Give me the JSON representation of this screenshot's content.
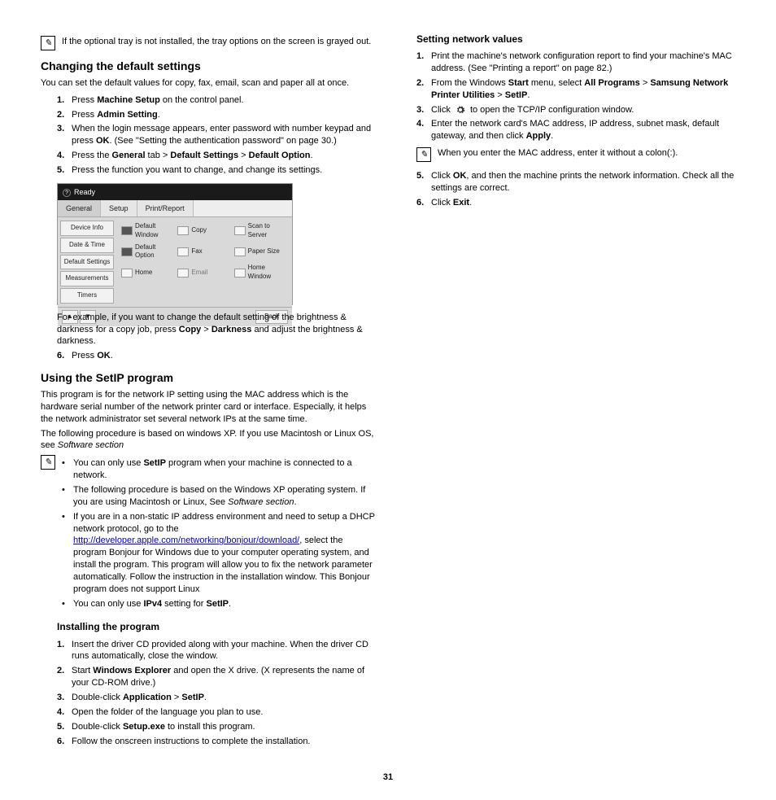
{
  "page_number": "31",
  "left": {
    "note_top": "If the optional tray is not installed, the tray options on the screen is grayed out.",
    "h_changing": "Changing the default settings",
    "p_changing": "You can set the default values for copy, fax, email, scan and paper all at once.",
    "steps_changing": [
      {
        "pre": "Press ",
        "b": "Machine Setup",
        "post": " on the control panel."
      },
      {
        "pre": "Press ",
        "b": "Admin Setting",
        "post": "."
      },
      {
        "pre": "When the login message appears, enter password with number keypad and press ",
        "b": "OK",
        "post": ". (See \"Setting the authentication password\" on page 30.)"
      },
      {
        "pre": "Press the ",
        "b": "General",
        "mid": " tab > ",
        "b2": "Default Settings",
        "mid2": " > ",
        "b3": "Default Option",
        "post": "."
      },
      {
        "pre": "Press the function you want to change, and change its settings.",
        "b": "",
        "post": ""
      }
    ],
    "screenshot": {
      "status": "Ready",
      "tabs": [
        "General",
        "Setup",
        "Print/Report"
      ],
      "side": [
        "Device Info",
        "Date & Time",
        "Default Settings",
        "Measurements",
        "Timers"
      ],
      "grid": [
        [
          "Default Window",
          "Copy",
          "Scan to Server"
        ],
        [
          "Default Option",
          "Fax",
          "Paper Size"
        ],
        [
          "Home",
          "Email",
          "Home Window"
        ]
      ],
      "back": "Back"
    },
    "p_example": "For example, if you want to change the default setting of the brightness & darkness for a copy job, press ",
    "p_example_b1": "Copy",
    "p_example_mid": " > ",
    "p_example_b2": "Darkness",
    "p_example_post": " and adjust the brightness & darkness.",
    "step6_changing": {
      "pre": "Press ",
      "b": "OK",
      "post": "."
    },
    "h_setip": "Using the SetIP program",
    "p_setip1": "This program is for the network IP setting using the MAC address which is the hardware serial number of the network printer card or interface. Especially, it helps the network administrator set several network IPs at the same time.",
    "p_setip2_pre": "The following procedure is based on windows XP. If you use Macintosh or Linux OS, see ",
    "p_setip2_i": "Software section",
    "note_setip": {
      "items": [
        {
          "pre": "You can only use ",
          "b": "SetIP",
          "post": " program when your machine is connected to a network."
        },
        {
          "pre": "The following procedure is based on the Windows XP operating system. If you are using Macintosh or Linux, See ",
          "i": "Software section",
          "post": "."
        },
        {
          "pre": "If you are in a non-static IP address environment and need to setup a DHCP network protocol, go to the ",
          "link": "http://developer.apple.com/networking/bonjour/download/",
          "post": ", select the program Bonjour for Windows due to your computer operating system, and install the program. This program will allow you to fix the network parameter automatically. Follow the instruction in the installation window. This Bonjour program does not support Linux"
        },
        {
          "pre": "You can only use ",
          "b": "IPv4",
          "mid": " setting for ",
          "b2": "SetIP",
          "post": "."
        }
      ]
    },
    "h_installing": "Installing the program",
    "steps_installing": [
      {
        "text": "Insert the driver CD provided along with your machine. When the driver CD runs automatically, close the window."
      },
      {
        "pre": "Start ",
        "b": "Windows Explorer",
        "post": " and open the X drive. (X represents the name of your CD-ROM drive.)"
      },
      {
        "pre": "Double-click ",
        "b": "Application",
        "mid": " > ",
        "b2": "SetIP",
        "post": "."
      },
      {
        "text": "Open the folder of the language you plan to use."
      },
      {
        "pre": "Double-click ",
        "b": "Setup.exe",
        "post": " to install this program."
      },
      {
        "text": "Follow the onscreen instructions to complete the installation."
      }
    ]
  },
  "right": {
    "h_network": "Setting network values",
    "steps_network": [
      {
        "text": "Print the machine's network configuration report to find your machine's MAC address.  (See \"Printing a report\" on page 82.)"
      },
      {
        "pre": "From the Windows ",
        "b": "Start",
        "mid": " menu, select ",
        "b2": "All Programs",
        "mid2": " > ",
        "b3": "Samsung Network Printer Utilities",
        "mid3": " > ",
        "b4": "SetIP",
        "post": "."
      },
      {
        "pre": "Click ",
        "icon": true,
        "post": " to open the TCP/IP configuration window."
      },
      {
        "pre": "Enter the network card's MAC address, IP address, subnet mask, default gateway, and then click ",
        "b": "Apply",
        "post": "."
      }
    ],
    "note_mac": "When you enter the MAC address, enter it without a colon(:).",
    "step5": {
      "pre": "Click ",
      "b": "OK",
      "post": ", and then the machine prints the network information. Check all the settings are correct."
    },
    "step6": {
      "pre": "Click ",
      "b": "Exit",
      "post": "."
    }
  }
}
